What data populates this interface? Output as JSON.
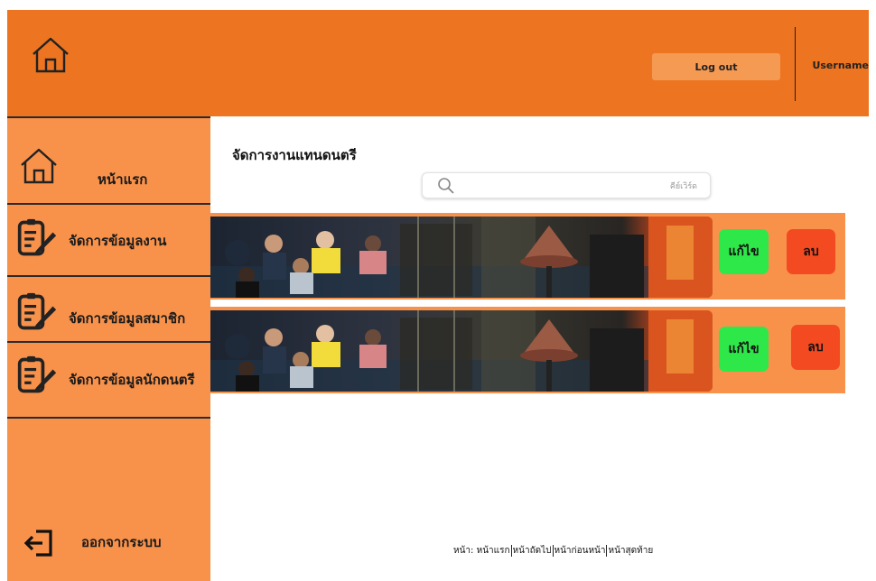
{
  "header": {
    "logout_label": "Log out",
    "username": "Username"
  },
  "sidebar": {
    "items": [
      {
        "label": "หน้าแรก",
        "icon": "home-icon"
      },
      {
        "label": "จัดการข้อมูลงาน",
        "icon": "document-edit-icon"
      },
      {
        "label": "จัดการข้อมูลสมาชิก",
        "icon": "document-edit-icon"
      },
      {
        "label": "จัดการข้อมูลนักดนตรี",
        "icon": "document-edit-icon"
      }
    ],
    "logout_label": "ออกจากระบบ"
  },
  "main": {
    "title": "จัดการงานแทนดนตรี",
    "search_placeholder": "คีย์เวิร์ด",
    "rows": [
      {
        "edit_label": "แก้ไข",
        "delete_label": "ลบ"
      },
      {
        "edit_label": "แก้ไข",
        "delete_label": "ลบ"
      }
    ]
  },
  "pagination": {
    "prefix": "หน้า:",
    "first": "หน้าแรก",
    "next": "หน้าถัดไป",
    "prev": "หน้าก่อนหน้า",
    "last": "หน้าสุดท้าย"
  },
  "colors": {
    "header": "#ed7420",
    "sidebar": "#f8924b",
    "edit": "#2ee84a",
    "delete": "#f34a22"
  }
}
